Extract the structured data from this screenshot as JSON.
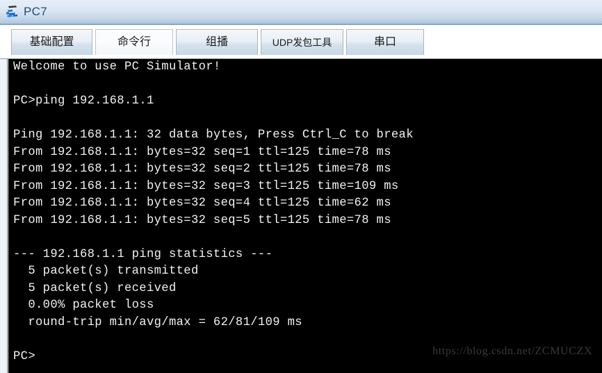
{
  "window": {
    "title": "PC7",
    "icon": "pc-network-icon"
  },
  "tabs": [
    {
      "label": "基础配置",
      "active": false,
      "name": "tab-basic-config"
    },
    {
      "label": "命令行",
      "active": true,
      "name": "tab-command-line"
    },
    {
      "label": "组播",
      "active": false,
      "name": "tab-multicast"
    },
    {
      "label": "UDP发包工具",
      "active": false,
      "name": "tab-udp-tool"
    },
    {
      "label": "串口",
      "active": false,
      "name": "tab-serial-port"
    }
  ],
  "terminal": {
    "prompt": "PC>",
    "command": "ping 192.168.1.1",
    "target_ip": "192.168.1.1",
    "output": "Welcome to use PC Simulator!\n\nPC>ping 192.168.1.1\n\nPing 192.168.1.1: 32 data bytes, Press Ctrl_C to break\nFrom 192.168.1.1: bytes=32 seq=1 ttl=125 time=78 ms\nFrom 192.168.1.1: bytes=32 seq=2 ttl=125 time=78 ms\nFrom 192.168.1.1: bytes=32 seq=3 ttl=125 time=109 ms\nFrom 192.168.1.1: bytes=32 seq=4 ttl=125 time=62 ms\nFrom 192.168.1.1: bytes=32 seq=5 ttl=125 time=78 ms\n\n--- 192.168.1.1 ping statistics ---\n  5 packet(s) transmitted\n  5 packet(s) received\n  0.00% packet loss\n  round-trip min/avg/max = 62/81/109 ms\n\nPC>",
    "lines": {
      "welcome": "Welcome to use PC Simulator!",
      "command_line": "PC>ping 192.168.1.1",
      "ping_header": "Ping 192.168.1.1: 32 data bytes, Press Ctrl_C to break",
      "reply_1": "From 192.168.1.1: bytes=32 seq=1 ttl=125 time=78 ms",
      "reply_2": "From 192.168.1.1: bytes=32 seq=2 ttl=125 time=78 ms",
      "reply_3": "From 192.168.1.1: bytes=32 seq=3 ttl=125 time=109 ms",
      "reply_4": "From 192.168.1.1: bytes=32 seq=4 ttl=125 time=62 ms",
      "reply_5": "From 192.168.1.1: bytes=32 seq=5 ttl=125 time=78 ms",
      "stats_header": "--- 192.168.1.1 ping statistics ---",
      "transmitted": "  5 packet(s) transmitted",
      "received": "  5 packet(s) received",
      "loss": "  0.00% packet loss",
      "round_trip": "  round-trip min/avg/max = 62/81/109 ms",
      "final_prompt": "PC>"
    },
    "stats": {
      "packets_transmitted": 5,
      "packets_received": 5,
      "packet_loss_percent": "0.00%",
      "rtt_min_ms": 62,
      "rtt_avg_ms": 81,
      "rtt_max_ms": 109,
      "data_bytes": 32,
      "ttl": 125,
      "times_ms": [
        78,
        78,
        109,
        62,
        78
      ]
    }
  },
  "watermark": {
    "text": "https://blog.csdn.net/ZCMUCZX"
  },
  "colors": {
    "titlebar_top": "#e6eef7",
    "titlebar_bottom": "#aec6de",
    "title_text": "#1f4e79",
    "terminal_bg": "#000000",
    "terminal_fg": "#f2f2f2",
    "watermark_fg": "#3a3a3a"
  }
}
